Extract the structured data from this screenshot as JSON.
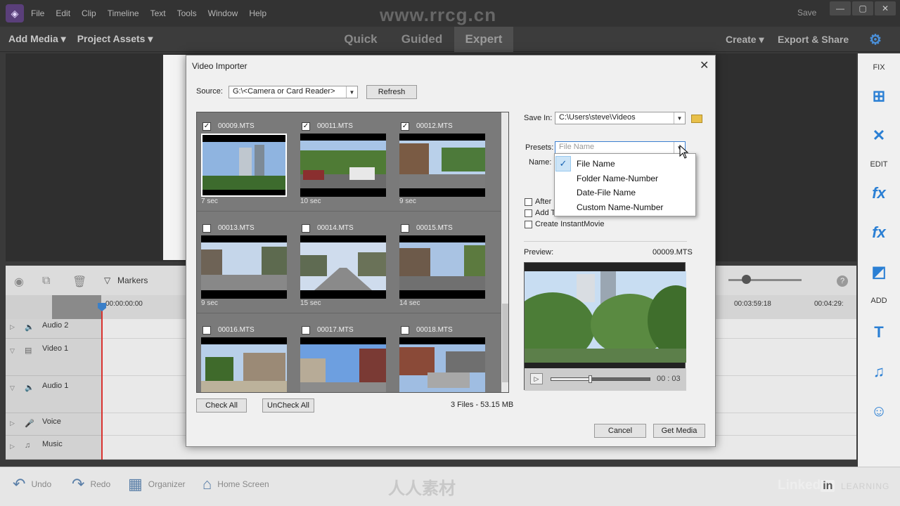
{
  "menu": {
    "items": [
      "File",
      "Edit",
      "Clip",
      "Timeline",
      "Text",
      "Tools",
      "Window",
      "Help"
    ],
    "watermark": "www.rrcg.cn",
    "save": "Save",
    "win_minimize": "—",
    "win_restore": "▢",
    "win_close": "✕",
    "logo_icon": "◈"
  },
  "modebar": {
    "add_media": "Add Media ▾",
    "project_assets": "Project Assets ▾",
    "tabs": [
      "Quick",
      "Guided",
      "Expert"
    ],
    "active_tab": "Expert",
    "create": "Create ▾",
    "export_share": "Export & Share",
    "gear_icon": "⚙"
  },
  "right_panel": {
    "fix": "FIX",
    "edit": "EDIT",
    "add": "ADD",
    "icons": {
      "adjust": "⊞",
      "tools": "✕",
      "fx_edit": "fx",
      "fx": "fx",
      "transitions": "◩",
      "text": "T",
      "music": "♫",
      "emoji": "☺"
    }
  },
  "timeline": {
    "markers": "Markers",
    "time_start": "00:00:00:00",
    "time_a": "00:03:59:18",
    "time_b": "00:04:29:",
    "tracks": [
      {
        "name": "Audio 2",
        "icon": "🔈"
      },
      {
        "name": "Video 1",
        "icon": "▤"
      },
      {
        "name": "Audio 1",
        "icon": "🔈"
      },
      {
        "name": "Voice",
        "icon": "🎤"
      },
      {
        "name": "Music",
        "icon": "♫"
      }
    ],
    "toolbar_icons": {
      "camera": "◉",
      "swap": "⧉",
      "trash": "🗑",
      "marker": "▽",
      "help": "?"
    }
  },
  "bottombar": {
    "undo": "Undo",
    "redo": "Redo",
    "organizer": "Organizer",
    "home_screen": "Home Screen",
    "brand": "人人素材",
    "linkedin_a": "Linked",
    "linkedin_b": "in",
    "learning": "LEARNING",
    "icons": {
      "undo": "↶",
      "redo": "↷",
      "organizer": "▦",
      "home": "⌂"
    }
  },
  "dialog": {
    "title": "Video Importer",
    "close": "✕",
    "source_label": "Source:",
    "source_value": "G:\\<Camera or Card Reader>",
    "refresh": "Refresh",
    "save_in_label": "Save In:",
    "save_in_value": "C:\\Users\\steve\\Videos",
    "presets_label": "Presets:",
    "presets_value": "File Name",
    "name_label": "Name:",
    "options": [
      "After",
      "Add T",
      "Create InstantMovie"
    ],
    "preview_label": "Preview:",
    "preview_file": "00009.MTS",
    "preview_time": "00 : 03",
    "preview_progress": 0.4,
    "check_all": "Check All",
    "uncheck_all": "UnCheck All",
    "summary": "3 Files - 53.15 MB",
    "cancel": "Cancel",
    "get_media": "Get Media",
    "clips": [
      {
        "name": "00009.MTS",
        "duration": "7 sec",
        "checked": true,
        "selected": true
      },
      {
        "name": "00011.MTS",
        "duration": "10 sec",
        "checked": true,
        "selected": false
      },
      {
        "name": "00012.MTS",
        "duration": "9 sec",
        "checked": true,
        "selected": false
      },
      {
        "name": "00013.MTS",
        "duration": "9 sec",
        "checked": false,
        "selected": false
      },
      {
        "name": "00014.MTS",
        "duration": "15 sec",
        "checked": false,
        "selected": false
      },
      {
        "name": "00015.MTS",
        "duration": "14 sec",
        "checked": false,
        "selected": false
      },
      {
        "name": "00016.MTS",
        "duration": "",
        "checked": false,
        "selected": false
      },
      {
        "name": "00017.MTS",
        "duration": "",
        "checked": false,
        "selected": false
      },
      {
        "name": "00018.MTS",
        "duration": "",
        "checked": false,
        "selected": false
      }
    ]
  },
  "presets_dropdown": {
    "items": [
      "File Name",
      "Folder Name-Number",
      "Date-File Name",
      "Custom Name-Number"
    ],
    "selected": "File Name"
  }
}
